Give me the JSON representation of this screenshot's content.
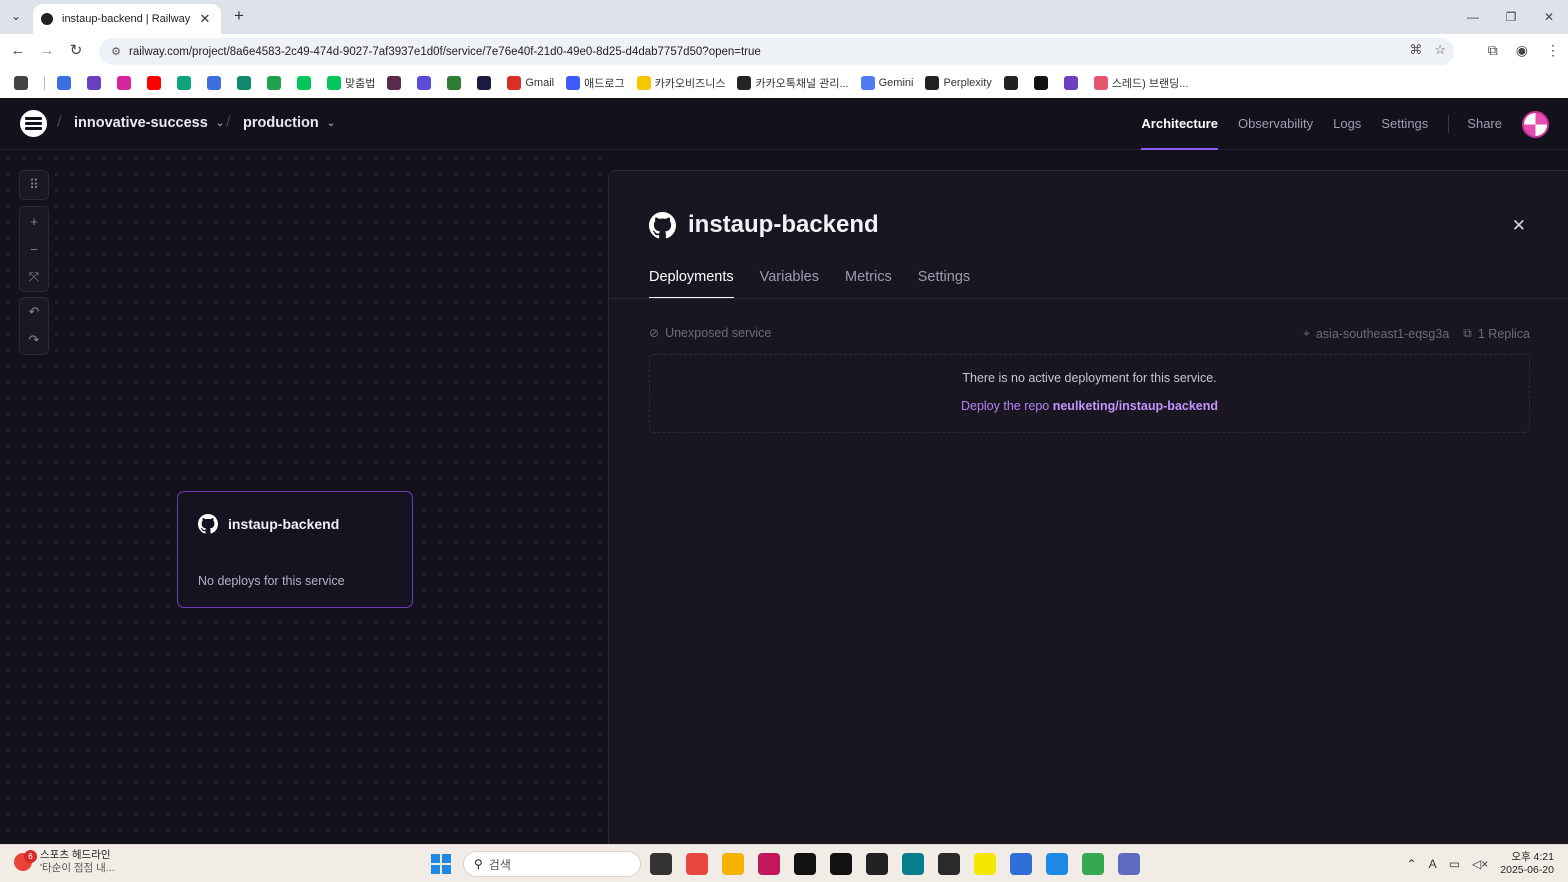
{
  "browser": {
    "tab_title": "instaup-backend | Railway",
    "url": "railway.com/project/8a6e4583-2c49-474d-9027-7af3937e1d0f/service/7e76e40f-21d0-49e0-8d25-d4dab7757d50?open=true",
    "bookmarks": [
      {
        "label": "",
        "icon": "apps-grid-icon",
        "color": "#444444"
      },
      {
        "label": "",
        "icon": "sparkle-icon",
        "color": "#3b6fe0"
      },
      {
        "label": "",
        "icon": "form-icon",
        "color": "#6a3fc0"
      },
      {
        "label": "",
        "icon": "instagram-icon",
        "color": "#d6249f"
      },
      {
        "label": "",
        "icon": "youtube-icon",
        "color": "#ff0000"
      },
      {
        "label": "",
        "icon": "app-icon",
        "color": "#10a37f"
      },
      {
        "label": "",
        "icon": "sparkle-icon",
        "color": "#3b6fe0"
      },
      {
        "label": "",
        "icon": "edge-icon",
        "color": "#0f8a6e"
      },
      {
        "label": "",
        "icon": "leaf-icon",
        "color": "#1fa34a"
      },
      {
        "label": "",
        "icon": "naver-icon",
        "color": "#03c75a"
      },
      {
        "label": "맞춤법",
        "icon": "naver-icon",
        "color": "#03c75a"
      },
      {
        "label": "",
        "icon": "book-icon",
        "color": "#5a2a4a"
      },
      {
        "label": "",
        "icon": "search-q-icon",
        "color": "#5b4bd6"
      },
      {
        "label": "",
        "icon": "pen-icon",
        "color": "#2e7d32"
      },
      {
        "label": "",
        "icon": "dark-app-icon",
        "color": "#1a1a40"
      },
      {
        "label": "Gmail",
        "icon": "gmail-icon",
        "color": "#d93025"
      },
      {
        "label": "애드로그",
        "icon": "adlog-icon",
        "color": "#3d5afe"
      },
      {
        "label": "카카오비즈니스",
        "icon": "kakao-k-icon",
        "color": "#f7c600"
      },
      {
        "label": "카카오톡채널 관리...",
        "icon": "kakao-channel-icon",
        "color": "#222222"
      },
      {
        "label": "Gemini",
        "icon": "gemini-icon",
        "color": "#4f7cf0"
      },
      {
        "label": "Perplexity",
        "icon": "perplexity-icon",
        "color": "#222222"
      },
      {
        "label": "",
        "icon": "openai-icon",
        "color": "#222222"
      },
      {
        "label": "",
        "icon": "notion-icon",
        "color": "#111111"
      },
      {
        "label": "",
        "icon": "form-icon",
        "color": "#6a3fc0"
      },
      {
        "label": "스레드) 브랜딩...",
        "icon": "threads-icon",
        "color": "#e5566e"
      }
    ]
  },
  "header": {
    "project": "innovative-success",
    "environment": "production",
    "nav": [
      {
        "label": "Architecture",
        "active": true
      },
      {
        "label": "Observability",
        "active": false
      },
      {
        "label": "Logs",
        "active": false
      },
      {
        "label": "Settings",
        "active": false
      }
    ],
    "share": "Share"
  },
  "canvas": {
    "service_card": {
      "name": "instaup-backend",
      "status": "No deploys for this service"
    }
  },
  "panel": {
    "title": "instaup-backend",
    "tabs": [
      {
        "label": "Deployments",
        "active": true
      },
      {
        "label": "Variables",
        "active": false
      },
      {
        "label": "Metrics",
        "active": false
      },
      {
        "label": "Settings",
        "active": false
      }
    ],
    "exposure": "Unexposed service",
    "region": "asia-southeast1-eqsg3a",
    "replicas": "1 Replica",
    "empty_message": "There is no active deployment for this service.",
    "deploy_prefix": "Deploy the repo",
    "repo": "neulketing/instaup-backend"
  },
  "taskbar": {
    "news_badge": "6",
    "news_title": "스포츠 헤드라인",
    "news_sub": "'타순이 점점 내...",
    "search_placeholder": "검색",
    "time": "오후 4:21",
    "date": "2025-06-20",
    "apps": [
      {
        "icon": "file-explorer-task-icon",
        "color": "#333333"
      },
      {
        "icon": "chrome-icon",
        "color": "#e8453c"
      },
      {
        "icon": "folder-icon",
        "color": "#f4b400"
      },
      {
        "icon": "snipping-tool-icon",
        "color": "#c2185b"
      },
      {
        "icon": "capcut-icon",
        "color": "#111111"
      },
      {
        "icon": "notion-icon",
        "color": "#111111"
      },
      {
        "icon": "chatgpt-icon",
        "color": "#222222"
      },
      {
        "icon": "game-icon",
        "color": "#0a7d8c"
      },
      {
        "icon": "sticky-notes-icon",
        "color": "#2a2a2a"
      },
      {
        "icon": "kakaotalk-icon",
        "color": "#f7e600"
      },
      {
        "icon": "settings-app-icon",
        "color": "#2f6fd6"
      },
      {
        "icon": "notepad-icon",
        "color": "#1e88e5"
      },
      {
        "icon": "chrome-profile-icon",
        "color": "#34a853"
      },
      {
        "icon": "opgg-icon",
        "color": "#5c6bc0"
      }
    ]
  }
}
